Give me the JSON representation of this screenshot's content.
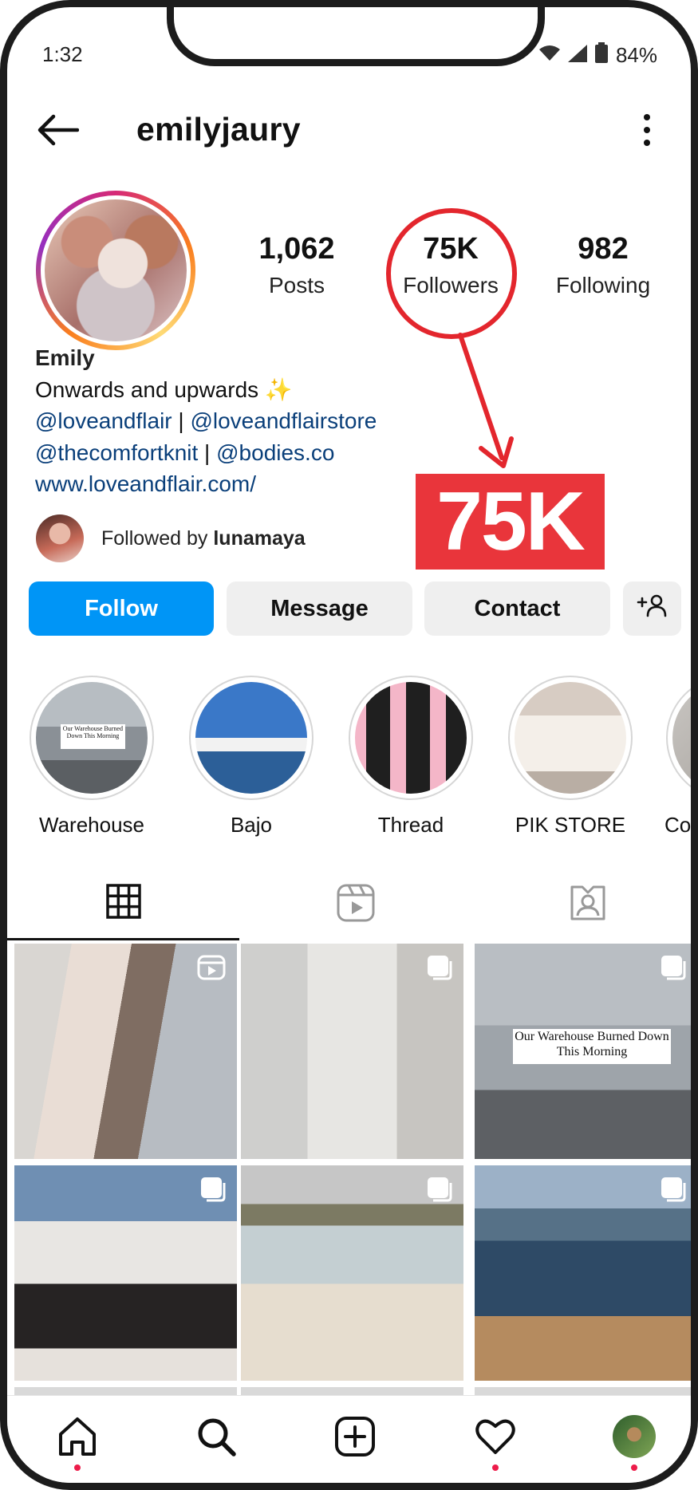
{
  "status_bar": {
    "time": "1:32",
    "battery": "84%"
  },
  "profile": {
    "username": "emilyjaury",
    "stats": [
      {
        "value": "1,062",
        "label": "Posts"
      },
      {
        "value": "75K",
        "label": "Followers"
      },
      {
        "value": "982",
        "label": "Following"
      }
    ],
    "name": "Emily",
    "bio_line": "Onwards and upwards ✨",
    "links_line1": {
      "a": "@loveandflair",
      "sep": " | ",
      "b": "@loveandflairstore"
    },
    "links_line2": {
      "a": "@thecomfortknit",
      "sep": " | ",
      "b": "@bodies.co"
    },
    "website": "www.loveandflair.com/",
    "followed_by_prefix": "Followed by ",
    "followed_by_user": "lunamaya"
  },
  "callout": {
    "text": "75K",
    "color": "#e9353b"
  },
  "buttons": {
    "follow": "Follow",
    "message": "Message",
    "contact": "Contact"
  },
  "highlights": [
    {
      "label": "Warehouse",
      "sign": "Our Warehouse Burned Down This Morning"
    },
    {
      "label": "Bajo"
    },
    {
      "label": "Thread"
    },
    {
      "label": "PIK STORE"
    },
    {
      "label": "Col"
    }
  ],
  "grid": {
    "sign_text": "Our Warehouse Burned Down This Morning"
  },
  "colors": {
    "follow_blue": "#0095f6",
    "link_blue": "#0a3f7a",
    "accent_red": "#e3262d"
  },
  "icons": {
    "back": "arrow-left-icon",
    "more": "vertical-dots-icon",
    "add_user": "add-user-icon",
    "grid_tab": "grid-icon",
    "reels_tab": "reels-icon",
    "tagged_tab": "tagged-icon",
    "nav": [
      "home-icon",
      "search-icon",
      "add-post-icon",
      "heart-icon",
      "profile-avatar"
    ]
  }
}
